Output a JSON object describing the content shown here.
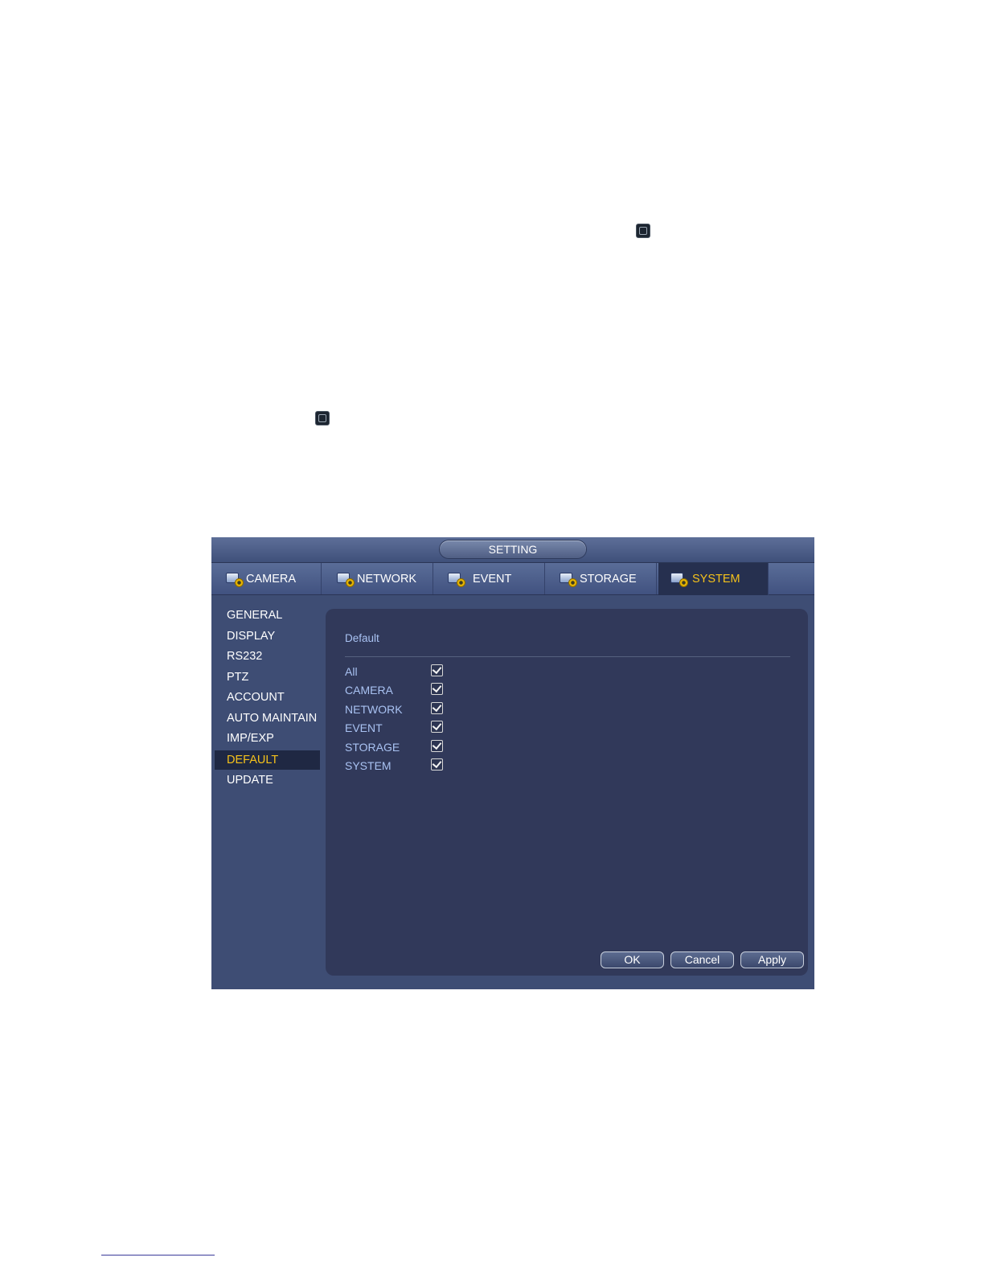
{
  "window": {
    "title": "SETTING"
  },
  "tabs": [
    {
      "label": "CAMERA",
      "icon": "camera-gear-icon",
      "active": false
    },
    {
      "label": "NETWORK",
      "icon": "network-gear-icon",
      "active": false
    },
    {
      "label": "EVENT",
      "icon": "event-gear-icon",
      "active": false
    },
    {
      "label": "STORAGE",
      "icon": "storage-gear-icon",
      "active": false
    },
    {
      "label": "SYSTEM",
      "icon": "system-gear-icon",
      "active": true
    }
  ],
  "sidebar": {
    "items": [
      {
        "label": "GENERAL",
        "active": false
      },
      {
        "label": "DISPLAY",
        "active": false
      },
      {
        "label": "RS232",
        "active": false
      },
      {
        "label": "PTZ",
        "active": false
      },
      {
        "label": "ACCOUNT",
        "active": false
      },
      {
        "label": "AUTO MAINTAIN",
        "active": false
      },
      {
        "label": "IMP/EXP",
        "active": false
      },
      {
        "label": "DEFAULT",
        "active": true
      },
      {
        "label": "UPDATE",
        "active": false
      }
    ]
  },
  "panel": {
    "title": "Default",
    "options": [
      {
        "label": "All",
        "checked": true
      },
      {
        "label": "CAMERA",
        "checked": true
      },
      {
        "label": "NETWORK",
        "checked": true
      },
      {
        "label": "EVENT",
        "checked": true
      },
      {
        "label": "STORAGE",
        "checked": true
      },
      {
        "label": "SYSTEM",
        "checked": true
      }
    ]
  },
  "buttons": {
    "ok": "OK",
    "cancel": "Cancel",
    "apply": "Apply"
  },
  "colors": {
    "active_text": "#f5c21b",
    "label_text": "#a9c2f2",
    "panel_bg": "#31395a",
    "window_bg": "#3e4d74"
  }
}
